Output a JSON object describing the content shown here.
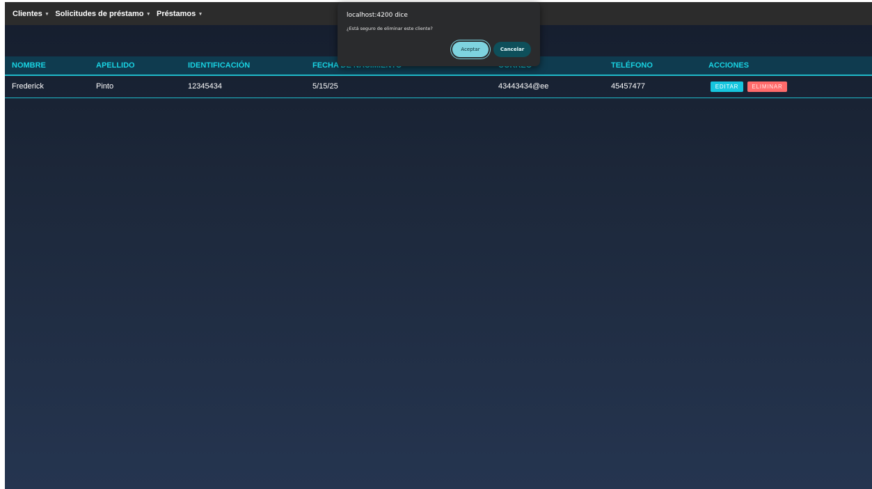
{
  "navbar": {
    "items": [
      {
        "label": "Clientes",
        "caret": "▾"
      },
      {
        "label": "Solicitudes de préstamo",
        "caret": "▾"
      },
      {
        "label": "Préstamos",
        "caret": "▾"
      }
    ]
  },
  "table": {
    "headers": [
      "NOMBRE",
      "APELLIDO",
      "IDENTIFICACIÓN",
      "FECHA DE NACIMIENTO",
      "CORREO",
      "TELÉFONO",
      "ACCIONES"
    ],
    "rows": [
      {
        "nombre": "Frederick",
        "apellido": "Pinto",
        "identificacion": "12345434",
        "fecha": "5/15/25",
        "correo": "43443434@ee",
        "telefono": "45457477",
        "edit_label": "EDITAR",
        "delete_label": "ELIMINAR"
      }
    ]
  },
  "dialog": {
    "title": "localhost:4200 dice",
    "message": "¿Está seguro de eliminar este cliente?",
    "ok_label": "Aceptar",
    "cancel_label": "Cancelar"
  },
  "colors": {
    "accent": "#19d3e3",
    "edit_button": "#16c6de",
    "delete_button": "#ff6b6b",
    "navbar": "#2c2c2c"
  }
}
